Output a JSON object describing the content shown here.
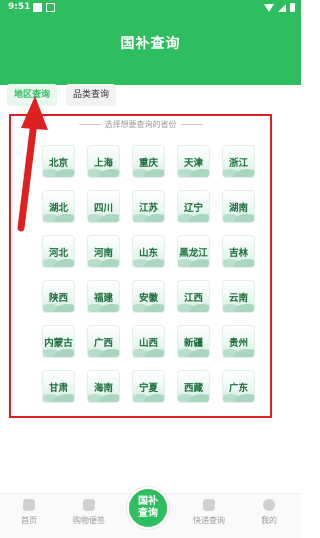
{
  "status_bar": {
    "time": "9:51"
  },
  "header": {
    "title": "国补查询"
  },
  "tabs": [
    {
      "label": "地区查询",
      "active": true
    },
    {
      "label": "品类查询",
      "active": false
    }
  ],
  "panel": {
    "hint": "选择想要查询的省份",
    "provinces": [
      "北京",
      "上海",
      "重庆",
      "天津",
      "浙江",
      "湖北",
      "四川",
      "江苏",
      "辽宁",
      "湖南",
      "河北",
      "河南",
      "山东",
      "黑龙江",
      "吉林",
      "陕西",
      "福建",
      "安徽",
      "江西",
      "云南",
      "内蒙古",
      "广西",
      "山西",
      "新疆",
      "贵州",
      "甘肃",
      "海南",
      "宁夏",
      "西藏",
      "广东"
    ]
  },
  "bottom_nav": {
    "items": [
      {
        "label": "首页",
        "icon": "home-icon"
      },
      {
        "label": "购物便签",
        "icon": "note-icon"
      },
      {
        "label": "快递查询",
        "icon": "package-icon"
      },
      {
        "label": "我的",
        "icon": "profile-icon"
      }
    ],
    "center_label": "国补查询"
  },
  "colors": {
    "brand_green": "#2ebd5f",
    "highlight_red": "#e02020"
  }
}
